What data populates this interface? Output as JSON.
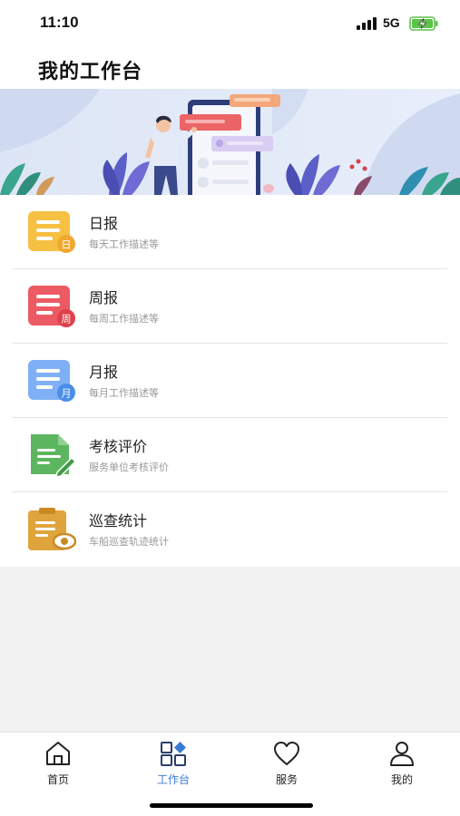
{
  "status_bar": {
    "time": "11:10",
    "network": "5G"
  },
  "header": {
    "title": "我的工作台"
  },
  "menu": [
    {
      "label": "日报",
      "desc": "每天工作描述等",
      "badge": "日",
      "icon": "daily-report-icon",
      "color": "#f6c043",
      "badge_color": "#f0a830"
    },
    {
      "label": "周报",
      "desc": "每周工作描述等",
      "badge": "周",
      "icon": "weekly-report-icon",
      "color": "#ec5b63",
      "badge_color": "#e0404a"
    },
    {
      "label": "月报",
      "desc": "每月工作描述等",
      "badge": "月",
      "icon": "monthly-report-icon",
      "color": "#7fb0f5",
      "badge_color": "#4a8ee8"
    },
    {
      "label": "考核评价",
      "desc": "服务单位考核评价",
      "icon": "evaluation-document-icon",
      "color": "#5cb65f"
    },
    {
      "label": "巡查统计",
      "desc": "车船巡查轨迹统计",
      "icon": "patrol-clipboard-icon",
      "color": "#e0a43c"
    }
  ],
  "tabbar": {
    "active_color": "#3a7bd5",
    "tabs": [
      {
        "label": "首页",
        "icon": "home-icon"
      },
      {
        "label": "工作台",
        "icon": "workbench-icon"
      },
      {
        "label": "服务",
        "icon": "heart-icon"
      },
      {
        "label": "我的",
        "icon": "user-icon"
      }
    ]
  }
}
